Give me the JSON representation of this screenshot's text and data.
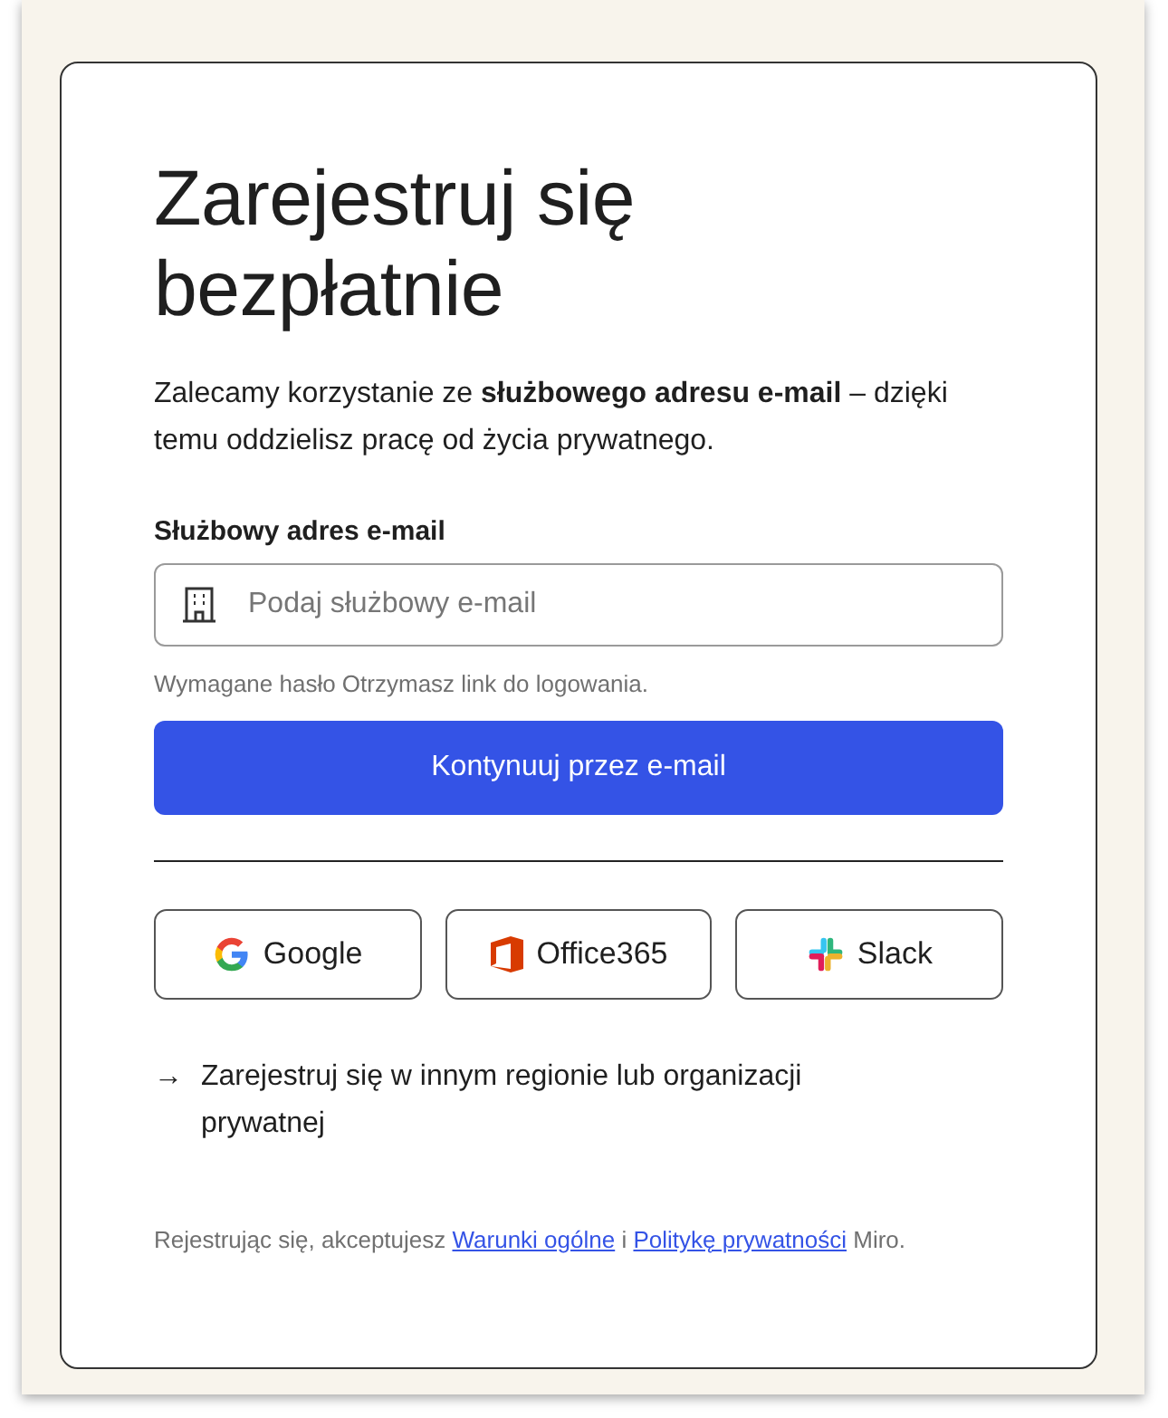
{
  "title": "Zarejestruj się bezpłatnie",
  "intro": "Zalecamy korzystanie ze **służbowego adresu e-mail** – dzięki temu oddzielisz pracę od życia prywatnego.",
  "email_field": {
    "label": "Służbowy adres e-mail",
    "placeholder": "Podaj służbowy e-mail"
  },
  "hint": "Wymagane hasło Otrzymasz link do logowania.",
  "continue_button": "Kontynuuj przez e-mail",
  "social_buttons": [
    {
      "kind": "google",
      "label": "Google"
    },
    {
      "kind": "office",
      "label": "Office365"
    },
    {
      "kind": "slack",
      "label": "Slack"
    }
  ],
  "region_link": {
    "arrow": "→",
    "label": "Zarejestruj się w innym regionie lub organizacji prywatnej"
  },
  "terms": [
    {
      "kind": "text",
      "text": "Rejestrując się, akceptujesz "
    },
    {
      "kind": "link",
      "text": "Warunki ogólne"
    },
    {
      "kind": "text",
      "text": " i "
    },
    {
      "kind": "link",
      "text": "Politykę prywatności"
    },
    {
      "kind": "text",
      "text": " Miro."
    }
  ]
}
